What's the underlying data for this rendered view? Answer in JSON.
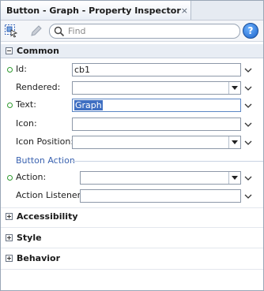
{
  "window": {
    "title": "Button - Graph - Property Inspector",
    "close_glyph": "×"
  },
  "toolbar": {
    "search_placeholder": "Find",
    "help_glyph": "?"
  },
  "sections": {
    "common": {
      "label": "Common",
      "fields": {
        "id": {
          "label": "Id:",
          "value": "cb1"
        },
        "rendered": {
          "label": "Rendered:",
          "value": ""
        },
        "text": {
          "label": "Text:",
          "value": "Graph"
        },
        "icon": {
          "label": "Icon:",
          "value": ""
        },
        "icon_position": {
          "label": "Icon Position:",
          "value": ""
        }
      },
      "button_action": {
        "heading": "Button Action",
        "action": {
          "label": "Action:",
          "value": ""
        },
        "action_listener": {
          "label": "Action Listener:",
          "value": ""
        }
      }
    },
    "accessibility": {
      "label": "Accessibility"
    },
    "style": {
      "label": "Style"
    },
    "behavior": {
      "label": "Behavior"
    }
  }
}
